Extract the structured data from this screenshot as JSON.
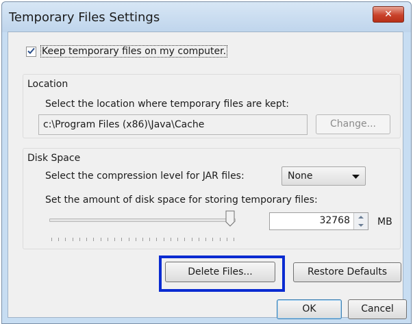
{
  "window": {
    "title": "Temporary Files Settings",
    "close_label": "✕"
  },
  "keep_files": {
    "label": "Keep temporary files on my computer.",
    "checked": true
  },
  "location": {
    "group_title": "Location",
    "description": "Select the location where temporary files are kept:",
    "path": "c:\\Program Files (x86)\\Java\\Cache",
    "change_button": "Change..."
  },
  "disk_space": {
    "group_title": "Disk Space",
    "compression_label": "Select the compression level for JAR files:",
    "compression_value": "None",
    "amount_label": "Set the amount of disk space for storing temporary files:",
    "amount_value": "32768",
    "unit": "MB",
    "slider_level": 0.95
  },
  "buttons": {
    "delete_files": "Delete Files...",
    "restore_defaults": "Restore Defaults",
    "ok": "OK",
    "cancel": "Cancel"
  },
  "colors": {
    "highlight": "#0a2bd1",
    "close_button": "#c9422b"
  }
}
